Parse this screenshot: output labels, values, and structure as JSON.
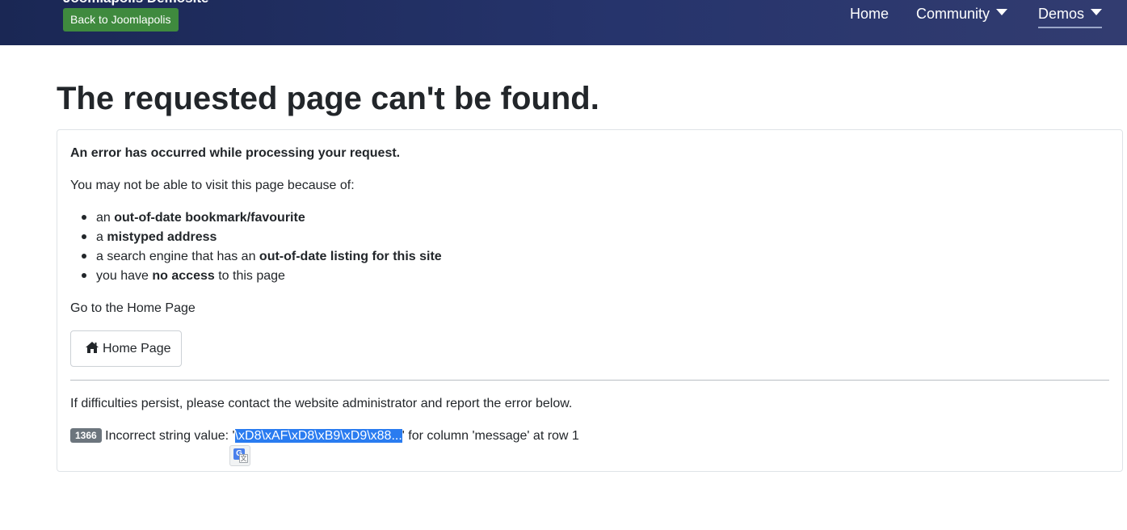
{
  "header": {
    "site_title": "Joomlapolis Demosite",
    "back_button": "Back to Joomlapolis",
    "nav": {
      "home": "Home",
      "community": "Community",
      "demos": "Demos"
    }
  },
  "page_title": "The requested page can't be found.",
  "error_box": {
    "heading": "An error has occurred while processing your request.",
    "intro": "You may not be able to visit this page because of:",
    "reasons": [
      {
        "before": "an ",
        "bold": "out-of-date bookmark/favourite",
        "after": ""
      },
      {
        "before": "a ",
        "bold": "mistyped address",
        "after": ""
      },
      {
        "before": "a search engine that has an ",
        "bold": "out-of-date listing for this site",
        "after": ""
      },
      {
        "before": "you have ",
        "bold": "no access",
        "after": " to this page"
      }
    ],
    "goto_text": "Go to the Home Page",
    "home_button": "Home Page",
    "persist_text": "If difficulties persist, please contact the website administrator and report the error below.",
    "error_code": "1366",
    "error_prefix": " Incorrect string value: '",
    "error_selected": "\\xD8\\xAF\\xD8\\xB9\\xD9\\x88...",
    "error_suffix": "' for column 'message' at row 1"
  },
  "icons": {
    "home_button_icon": "home-icon",
    "translate_popup_icon": "google-translate-icon",
    "nav_dropdown_icon": "caret-down-icon"
  },
  "colors": {
    "header_bg": "#26346c",
    "back_button_bg": "#3f8a3e",
    "badge_bg": "#6c757d",
    "selection_bg": "#2a7cf0"
  }
}
